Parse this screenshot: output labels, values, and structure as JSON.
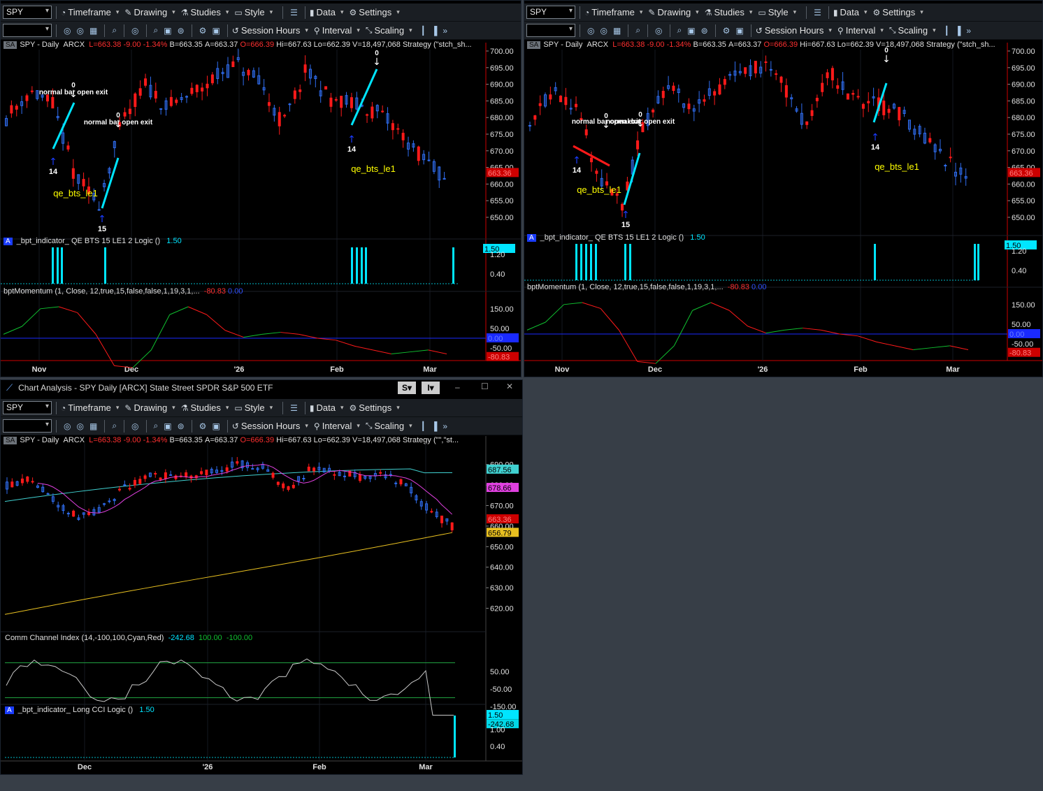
{
  "toolbar": {
    "symbol": "SPY",
    "timeframe": "Timeframe",
    "drawing": "Drawing",
    "studies": "Studies",
    "style": "Style",
    "data": "Data",
    "settings": "Settings",
    "session_hours": "Session Hours",
    "interval": "Interval",
    "scaling": "Scaling"
  },
  "chart_header": {
    "tag": "SA",
    "name": "SPY - Daily",
    "exchange": "ARCX",
    "last": "L=663.38",
    "change": "-9.00",
    "pct": "-1.34%",
    "bid": "B=663.35",
    "ask": "A=663.37",
    "open": "O=666.39",
    "high": "Hi=667.63",
    "low": "Lo=662.39",
    "volume": "V=18,497,068",
    "strategy_left": "Strategy (\"stch_sh...",
    "strategy_bottom": "Strategy (\"\",\"st..."
  },
  "windows": {
    "bottom_title": "Chart Analysis - SPY Daily [ARCX] State Street SPDR S&P 500 ETF",
    "s_button": "S",
    "i_button": "I",
    "minimize": "–",
    "maximize": "☐",
    "close": "✕"
  },
  "indicators": {
    "bpt_ind_a": "_bpt_indicator_ QE BTS 15 LE1 2 Logic ()",
    "bpt_ind_a_value": "1.50",
    "momentum": "bptMomentum (1, Close, 12,true,15,false,false,1,19,3,1,...",
    "momentum_value": "-80.83",
    "momentum_zero": "0.00",
    "cci": "Comm Channel Index (14,-100,100,Cyan,Red)",
    "cci_value": "-242.68",
    "cci_hi": "100.00",
    "cci_lo": "-100.00",
    "bpt_ind_b": "_bpt_indicator_ Long CCI Logic ()",
    "bpt_ind_b_value": "1.50",
    "tag": "A"
  },
  "annotations": {
    "exit_label": "normal bar open exit",
    "strategy_name": "qe_bts_le1",
    "zero": "0",
    "n14": "14",
    "n15": "15"
  },
  "axes": {
    "price_left": [
      "700.00",
      "695.00",
      "690.00",
      "685.00",
      "680.00",
      "675.00",
      "670.00",
      "665.00",
      "660.00",
      "655.00",
      "650.00"
    ],
    "price_right": [
      "700.00",
      "695.00",
      "690.00",
      "685.00",
      "680.00",
      "675.00",
      "670.00",
      "665.00",
      "660.00",
      "655.00",
      "650.00"
    ],
    "price_bottom": [
      "690.00",
      "680.00",
      "670.00",
      "660.00",
      "650.00",
      "640.00",
      "630.00",
      "620.00"
    ],
    "ind_a": [
      "1.20",
      "0.40"
    ],
    "mom": [
      "150.00",
      "50.00",
      "-50.00"
    ],
    "cci": [
      "50.00",
      "-50.00",
      "-150.00"
    ],
    "ind_b": [
      "1.00",
      "0.40"
    ],
    "months_top": [
      "Nov",
      "Dec",
      "'26",
      "Feb",
      "Mar"
    ],
    "months_bottom": [
      "Dec",
      "'26",
      "Feb",
      "Mar"
    ]
  },
  "price_flags": {
    "last": "663.36",
    "ind_last": "1.50",
    "mom_zero": "0.00",
    "mom_last": "-80.83",
    "ma_cyan": "687.56",
    "ma_magenta": "678.66",
    "ma_yellow": "656.79",
    "cci_last": "-242.68"
  },
  "colors": {
    "up": "#2f6df0",
    "down": "#ff1a1a",
    "cyan": "#00e5ff",
    "magenta": "#e040e0",
    "yellow": "#e8c020",
    "green": "#10c030",
    "bg": "#000000",
    "toolbar": "#1a1e23",
    "desktop": "#373e47"
  }
}
